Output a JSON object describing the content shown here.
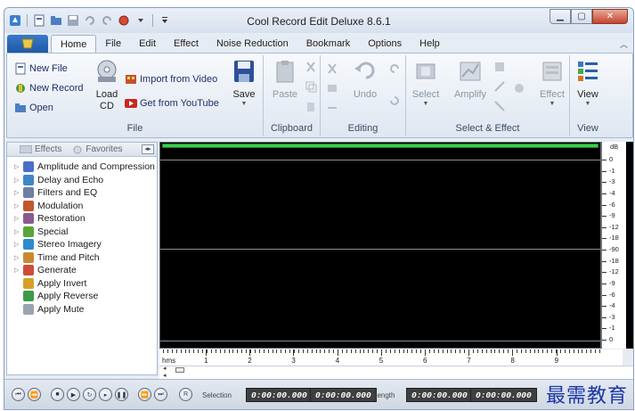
{
  "window": {
    "title": "Cool Record Edit Deluxe 8.6.1"
  },
  "tabs": [
    "Home",
    "File",
    "Edit",
    "Effect",
    "Noise Reduction",
    "Bookmark",
    "Options",
    "Help"
  ],
  "ribbon": {
    "file_group": {
      "label": "File",
      "new_file": "New File",
      "new_record": "New Record",
      "open": "Open",
      "load_cd": "Load CD",
      "import_video": "Import from Video",
      "get_youtube": "Get from YouTube",
      "save": "Save"
    },
    "clipboard_group": {
      "label": "Clipboard",
      "paste": "Paste"
    },
    "editing_group": {
      "label": "Editing",
      "undo": "Undo"
    },
    "select_group": {
      "label": "Select & Effect",
      "select": "Select",
      "amplify": "Amplify",
      "effect": "Effect"
    },
    "view_group": {
      "label": "View",
      "view": "View"
    }
  },
  "panel": {
    "tab_effects": "Effects",
    "tab_favorites": "Favorites",
    "items": [
      {
        "label": "Amplitude and Compression",
        "icon": "amplitude-icon",
        "color": "#4a6fc9",
        "expandable": true
      },
      {
        "label": "Delay and Echo",
        "icon": "delay-icon",
        "color": "#3f86c8",
        "expandable": true
      },
      {
        "label": "Filters and EQ",
        "icon": "filters-icon",
        "color": "#6e7fa0",
        "expandable": true
      },
      {
        "label": "Modulation",
        "icon": "modulation-icon",
        "color": "#c2562e",
        "expandable": true
      },
      {
        "label": "Restoration",
        "icon": "restoration-icon",
        "color": "#8a5a8f",
        "expandable": true
      },
      {
        "label": "Special",
        "icon": "special-icon",
        "color": "#5aa43a",
        "expandable": true
      },
      {
        "label": "Stereo Imagery",
        "icon": "stereo-icon",
        "color": "#2f8bc9",
        "expandable": true
      },
      {
        "label": "Time and Pitch",
        "icon": "time-pitch-icon",
        "color": "#c98a2f",
        "expandable": true
      },
      {
        "label": "Generate",
        "icon": "generate-icon",
        "color": "#d04a3a",
        "expandable": true
      },
      {
        "label": "Apply Invert",
        "icon": "invert-icon",
        "color": "#d8a02a",
        "expandable": false
      },
      {
        "label": "Apply Reverse",
        "icon": "reverse-icon",
        "color": "#3f9a4a",
        "expandable": false
      },
      {
        "label": "Apply Mute",
        "icon": "mute-icon",
        "color": "#9aa4b0",
        "expandable": false
      }
    ]
  },
  "db_scale": {
    "unit": "dB",
    "labels": [
      "0",
      "-1",
      "-3",
      "-4",
      "-6",
      "-9",
      "-12",
      "-18",
      "-90",
      "-18",
      "-12",
      "-9",
      "-6",
      "-4",
      "-3",
      "-1",
      "0"
    ]
  },
  "timeline": {
    "unit_label": "hms",
    "marks": [
      "1",
      "2",
      "3",
      "4",
      "5",
      "6",
      "7",
      "8",
      "9"
    ]
  },
  "status": {
    "selection_label": "Selection",
    "selection_start": "0:00:00.000",
    "selection_end": "0:00:00.000",
    "length_label": "Length",
    "length_start": "0:00:00.000",
    "length_end": "0:00:00.000",
    "watermark": "最需教育"
  }
}
